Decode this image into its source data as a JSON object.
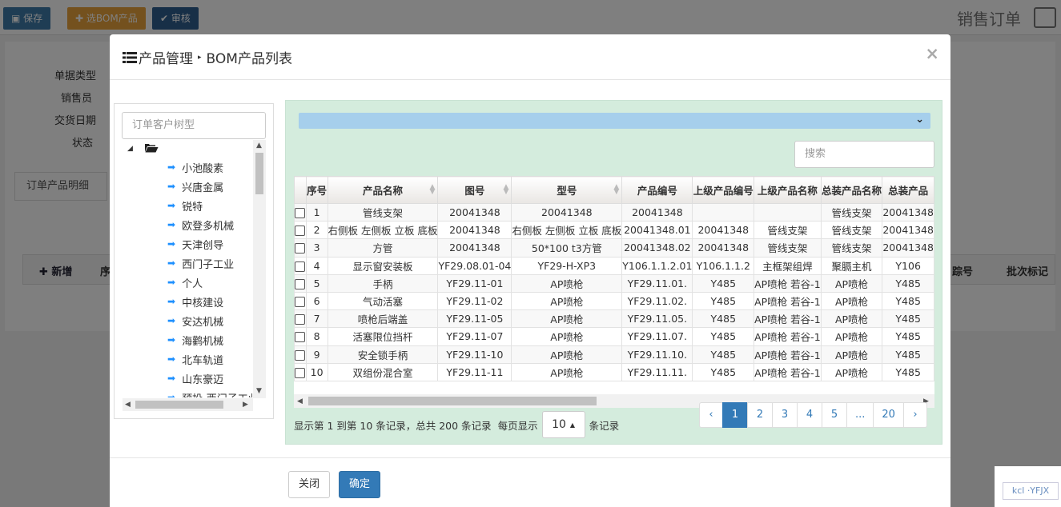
{
  "background": {
    "toolbar": {
      "save_label": "保存",
      "select_bom_label": "选BOM产品",
      "audit_label": "审核",
      "page_title": "销售订单"
    },
    "form_labels": [
      "单据类型",
      "销售员",
      "交货日期",
      "状态"
    ],
    "tab_label": "订单产品明细",
    "grid": {
      "add_label": "新增",
      "seq_header": "序",
      "trace_header": "踪号",
      "batch_header": "批次标记"
    }
  },
  "modal": {
    "title_main": "产品管理",
    "title_sub": "BOM产品列表",
    "close_glyph": "×",
    "tree": {
      "search_placeholder": "订单客户树型",
      "items": [
        "小池酸素",
        "兴唐金属",
        "锐特",
        "欧登多机械",
        "天津创导",
        "西门子工业",
        "个人",
        "中核建设",
        "安达机械",
        "海鹳机械",
        "北车轨道",
        "山东豪迈",
        "预投-西门子工业"
      ]
    },
    "grid": {
      "search_placeholder": "搜索",
      "columns": [
        "序号",
        "产品名称",
        "图号",
        "型号",
        "产品编号",
        "上级产品编号",
        "上级产品名称",
        "总装产品名称",
        "总装产品"
      ],
      "rows": [
        [
          "1",
          "管线支架",
          "20041348",
          "20041348",
          "20041348",
          "",
          "",
          "管线支架",
          "20041348"
        ],
        [
          "2",
          "右侧板 左侧板 立板 底板",
          "20041348",
          "右侧板 左侧板 立板 底板",
          "20041348.01",
          "20041348",
          "管线支架",
          "管线支架",
          "20041348"
        ],
        [
          "3",
          "方管",
          "20041348",
          "50*100 t3方管",
          "20041348.02",
          "20041348",
          "管线支架",
          "管线支架",
          "20041348"
        ],
        [
          "4",
          "显示窗安装板",
          "YF29.08.01-04",
          "YF29-H-XP3",
          "Y106.1.1.2.01",
          "Y106.1.1.2",
          "主框架组焊",
          "聚膈主机",
          "Y106"
        ],
        [
          "5",
          "手柄",
          "YF29.11-01",
          "AP喷枪",
          "YF29.11.01.",
          "Y485",
          "AP喷枪 若谷-1",
          "AP喷枪",
          "Y485"
        ],
        [
          "6",
          "气动活塞",
          "YF29.11-02",
          "AP喷枪",
          "YF29.11.02.",
          "Y485",
          "AP喷枪 若谷-1",
          "AP喷枪",
          "Y485"
        ],
        [
          "7",
          "喷枪后端盖",
          "YF29.11-05",
          "AP喷枪",
          "YF29.11.05.",
          "Y485",
          "AP喷枪 若谷-1",
          "AP喷枪",
          "Y485"
        ],
        [
          "8",
          "活塞限位挡杆",
          "YF29.11-07",
          "AP喷枪",
          "YF29.11.07.",
          "Y485",
          "AP喷枪 若谷-1",
          "AP喷枪",
          "Y485"
        ],
        [
          "9",
          "安全锁手柄",
          "YF29.11-10",
          "AP喷枪",
          "YF29.11.10.",
          "Y485",
          "AP喷枪 若谷-1",
          "AP喷枪",
          "Y485"
        ],
        [
          "10",
          "双组份混合室",
          "YF29.11-11",
          "AP喷枪",
          "YF29.11.11.",
          "Y485",
          "AP喷枪 若谷-1",
          "AP喷枪",
          "Y485"
        ]
      ],
      "pager_info_left": "显示第 1 到第 10 条记录，总共 200 条记录",
      "pager_per_page": "每页显示",
      "page_size": "10",
      "pager_info_right": "条记录",
      "pages": [
        "‹",
        "1",
        "2",
        "3",
        "4",
        "5",
        "...",
        "20",
        "›"
      ],
      "active_page": "1"
    },
    "footer": {
      "close_label": "关闭",
      "ok_label": "确定"
    }
  },
  "watermark": "kcl ·YFJX",
  "colors": {
    "primary": "#337ab7",
    "grid_panel_bg": "#d4ecdd",
    "blue_bar": "#a6cfec",
    "tree_arrow": "#1e90ff"
  }
}
